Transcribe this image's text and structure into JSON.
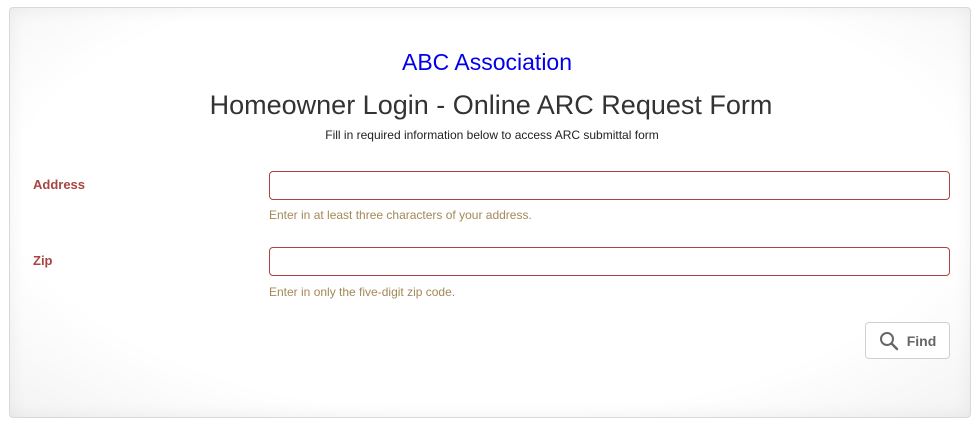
{
  "header": {
    "association": "ABC Association",
    "title": "Homeowner Login - Online ARC Request Form",
    "subtitle": "Fill in required information below to access ARC submittal form"
  },
  "form": {
    "address": {
      "label": "Address",
      "value": "",
      "help": "Enter in at least three characters of your address."
    },
    "zip": {
      "label": "Zip",
      "value": "",
      "help": "Enter in only the five-digit zip code."
    },
    "find_button": {
      "label": "Find",
      "icon": "search-icon"
    }
  },
  "colors": {
    "association_link": "#0000ee",
    "error_label": "#a94442",
    "help_text": "#a48858"
  }
}
